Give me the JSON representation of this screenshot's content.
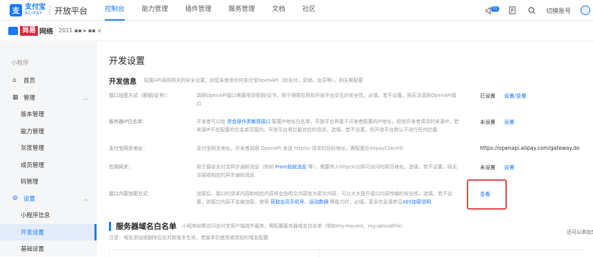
{
  "topnav": {
    "logo_glyph": "支",
    "logo_name": "支付宝",
    "logo_sub": "ALIPAY",
    "platform_title": "开放平台",
    "links": [
      "控制台",
      "能力管理",
      "插件管理",
      "服务管理",
      "文档",
      "社区"
    ],
    "active_index": 0,
    "notify_count": "31",
    "switch_account": "切换账号"
  },
  "subbar": {
    "brand_name": "尚易",
    "brand_sub": "网络",
    "app_id": "2011 ▪▪ ▸ ▪▪ ∨"
  },
  "sidebar": {
    "section_label": "小程序",
    "items": [
      {
        "label": "首页",
        "icon": "home-icon"
      },
      {
        "label": "管理",
        "icon": "grid-icon",
        "chevron": "︿"
      },
      {
        "label": "版本管理"
      },
      {
        "label": "能力管理"
      },
      {
        "label": "灰度管理"
      },
      {
        "label": "成员管理"
      },
      {
        "label": "码管理"
      },
      {
        "label": "设置",
        "icon": "gear-icon",
        "chevron": "︿"
      },
      {
        "label": "小程序信息"
      },
      {
        "label": "开发设置"
      },
      {
        "label": "基础设置"
      }
    ]
  },
  "main": {
    "title": "开发设置",
    "dev_info_title": "开发信息",
    "dev_info_desc": "配置API调用相关的安全设置，如您未使用任何支付宝OpenAPI（如支付、营销、会员等），则无需配置",
    "rows": [
      {
        "label": "接口加签方式（密钥/证书）：",
        "desc": "调用OpenAPI接口需要用到密钥/证书，用于保障应用和开放平台交互的安全性。必填，若不设置，则无法调用OpenAPI接口",
        "status": "已设置",
        "action": "设置/查看"
      },
      {
        "label": "服务器IP白名单：",
        "desc_a": "开发者可以给 ",
        "desc_link": "资金操作类敏感接口",
        "desc_b": " 配置IP地址白名单，开放平台将基于开发者配置的IP地址，校验开发者请求的来源IP，若来源IP不在配置的白名单范围内，开放平台将拦截对应的请求。选填，若不设置，则开放平台默认不进行任何拦截",
        "status": "未设置",
        "action": "设置"
      },
      {
        "label": "支付宝网关地址：",
        "desc": "支付宝网关地址，开发者调用 OpenAPI 发送 http(s) 请求的目标地址，需配置在AlipayClient中",
        "value": "https://openapi.alipay.com/gateway.do"
      },
      {
        "label": "应用网关：",
        "desc_a": "用于接收支付宝异步通知消息（例如 ",
        "desc_link": "From蚂蚁消息",
        "desc_b": " 等），需要传入http(s)公网可访问的网页地址。选填，若不设置，则无法接收相应的异步通知消息",
        "status": "未设置",
        "action": "设置"
      },
      {
        "label": "接口内容加密方式：",
        "desc_a": "加密后，接口的请求内容和响应内容将会由明文内容变为密文内容，可以大大提升接口内容传输的安全性。选填，若不设置，则接口内容不会被加密。使用 ",
        "desc_link": "获取会员手机号、运动数据",
        "desc_b": " 等能力时，必填。更多信息请参见",
        "desc_link2": "AES加密说明",
        "action": "查看"
      }
    ],
    "domain_title": "服务器域名白名单",
    "domain_desc": "小程序如需访问支付宝客户端域外服务，需配置服务器域名白名单（例如my.request、my.uploadFile）",
    "domain_note": "注意：域名添加或删除后仅对新版本生效，老版本仍使用修改前的域名配置",
    "right_note": "还可以添加50"
  },
  "colors": {
    "accent": "#1677ff",
    "highlight": "#e04444"
  }
}
